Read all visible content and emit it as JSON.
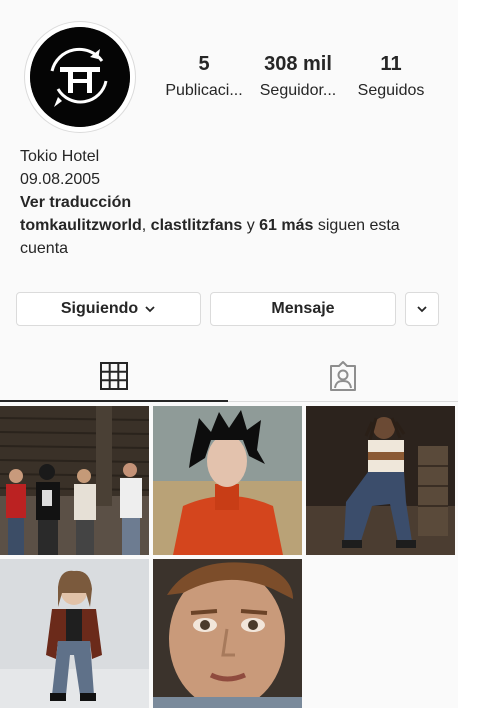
{
  "profile": {
    "name": "Tokio Hotel",
    "date": "09.08.2005",
    "translate": "Ver traducción",
    "followed_by": {
      "user1": "tomkaulitzworld",
      "sep": ", ",
      "user2": "clastlitzfans",
      "and": " y ",
      "more": "61 más",
      "suffix": " siguen esta cuenta"
    },
    "avatar_icon": "tokio-hotel-logo-icon"
  },
  "stats": [
    {
      "value": "5",
      "label": "Publicaci..."
    },
    {
      "value": "308 mil",
      "label": "Seguidor..."
    },
    {
      "value": "11",
      "label": "Seguidos"
    }
  ],
  "actions": {
    "following_label": "Siguiendo",
    "message_label": "Mensaje",
    "following_icon": "chevron-down-icon",
    "suggest_icon": "chevron-down-icon"
  },
  "tabs": [
    {
      "name": "grid",
      "icon": "grid-icon",
      "active": true
    },
    {
      "name": "tagged",
      "icon": "tagged-person-icon",
      "active": false
    }
  ],
  "posts": [
    {
      "id": 1,
      "subject": "group photo"
    },
    {
      "id": 2,
      "subject": "portrait black hair orange jacket"
    },
    {
      "id": 3,
      "subject": "seated dreadlocks"
    },
    {
      "id": 4,
      "subject": "standing leather jacket"
    },
    {
      "id": 5,
      "subject": "close-up face"
    }
  ],
  "colors": {
    "text": "#262626",
    "border": "#dbdbdb",
    "background": "#fafafa"
  }
}
